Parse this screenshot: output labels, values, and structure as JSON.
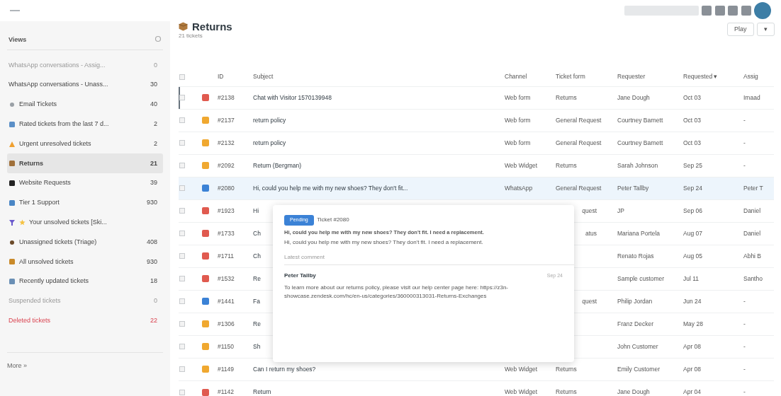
{
  "sidebar": {
    "title": "Views",
    "items": [
      {
        "label": "WhatsApp conversations - Assig...",
        "count": "0",
        "kind": "muted",
        "selected": false
      },
      {
        "label": "WhatsApp conversations - Unass...",
        "count": "30",
        "kind": "plain",
        "selected": false
      },
      {
        "label": "Email Tickets",
        "count": "40",
        "kind": "dot",
        "selected": false,
        "color": "#9aa0a6"
      },
      {
        "label": "Rated tickets from the last 7 d...",
        "count": "2",
        "kind": "folder",
        "selected": false,
        "color": "#5b8fc7"
      },
      {
        "label": "Urgent unresolved tickets",
        "count": "2",
        "kind": "warning",
        "selected": false,
        "color": "#f0a030"
      },
      {
        "label": "Returns",
        "count": "21",
        "kind": "folder",
        "selected": true,
        "color": "#a0703a"
      },
      {
        "label": "Website Requests",
        "count": "39",
        "kind": "folder",
        "selected": false,
        "color": "#222222"
      },
      {
        "label": "Tier 1 Support",
        "count": "930",
        "kind": "folder",
        "selected": false,
        "color": "#4a86c5"
      },
      {
        "label": "Your unsolved tickets [Ski...",
        "kind": "filter",
        "selected": false,
        "color": "#6a5acd"
      },
      {
        "label": "Unassigned tickets (Triage)",
        "count": "408",
        "kind": "dot",
        "selected": false,
        "color": "#6b4a2a"
      },
      {
        "label": "All unsolved tickets",
        "count": "930",
        "kind": "folder",
        "selected": false,
        "color": "#c98a2a"
      },
      {
        "label": "Recently updated tickets",
        "count": "18",
        "kind": "folder",
        "selected": false,
        "color": "#6a8fb5"
      },
      {
        "label": "Suspended tickets",
        "count": "0",
        "kind": "muted",
        "selected": false
      },
      {
        "label": "Deleted tickets",
        "count": "22",
        "kind": "deleted",
        "selected": false
      }
    ],
    "more": "More »"
  },
  "view": {
    "title": "Returns",
    "subtitle": "21 tickets",
    "play": "Play",
    "menu": "▾"
  },
  "table": {
    "select_all": {
      "checked": false
    },
    "columns": [
      "ID",
      "Subject",
      "Channel",
      "Ticket form",
      "Requester",
      "Requested ▾",
      "Assig"
    ],
    "rows": [
      {
        "checked": false,
        "focused": true,
        "hovered": false,
        "color": "#e05a4f",
        "id": "#2138",
        "subject": "Chat with Visitor 1570139948",
        "channel": "Web form",
        "form": "Returns",
        "requester": "Jane Dough",
        "requested": "Oct 03",
        "assignee": "Imaad"
      },
      {
        "checked": false,
        "focused": false,
        "hovered": false,
        "color": "#f0a830",
        "id": "#2137",
        "subject": "return policy",
        "channel": "Web form",
        "form": "General Request",
        "requester": "Courtney Barnett",
        "requested": "Oct 03",
        "assignee": "-"
      },
      {
        "checked": false,
        "focused": false,
        "hovered": false,
        "color": "#f0a830",
        "id": "#2132",
        "subject": "return policy",
        "channel": "Web form",
        "form": "General Request",
        "requester": "Courtney Barnett",
        "requested": "Oct 03",
        "assignee": "-"
      },
      {
        "checked": false,
        "focused": false,
        "hovered": false,
        "color": "#f0a830",
        "id": "#2092",
        "subject": "Return (Bergman)",
        "channel": "Web Widget",
        "form": "Returns",
        "requester": "Sarah Johnson",
        "requested": "Sep 25",
        "assignee": "-"
      },
      {
        "checked": false,
        "focused": false,
        "hovered": true,
        "color": "#3b82d6",
        "id": "#2080",
        "subject": "Hi, could you help me with my new shoes? They don't fit...",
        "channel": "WhatsApp",
        "form": "General Request",
        "requester": "Peter Tallby",
        "requested": "Sep 24",
        "assignee": "Peter T"
      },
      {
        "checked": false,
        "focused": false,
        "hovered": false,
        "color": "#e05a4f",
        "id": "#1923",
        "subject": "Hi",
        "covered": true,
        "form": "quest",
        "requester": "JP",
        "requested": "Sep 06",
        "assignee": "Daniel"
      },
      {
        "checked": false,
        "focused": false,
        "hovered": false,
        "color": "#e05a4f",
        "id": "#1733",
        "subject": "Ch",
        "covered": true,
        "form": "atus",
        "requester": "Mariana Portela",
        "requested": "Aug 07",
        "assignee": "Daniel"
      },
      {
        "checked": false,
        "focused": false,
        "hovered": false,
        "color": "#e05a4f",
        "id": "#1711",
        "subject": "Ch",
        "requester": "Renato Rojas",
        "requested": "Aug 05",
        "assignee": "Abhi B"
      },
      {
        "checked": false,
        "focused": false,
        "hovered": false,
        "color": "#e05a4f",
        "id": "#1532",
        "subject": "Re",
        "requester": "Sample customer",
        "requested": "Jul 11",
        "assignee": "Santho"
      },
      {
        "checked": false,
        "focused": false,
        "hovered": false,
        "color": "#3b82d6",
        "id": "#1441",
        "subject": "Fa",
        "covered": true,
        "form": "quest",
        "requester": "Philip Jordan",
        "requested": "Jun 24",
        "assignee": "-"
      },
      {
        "checked": false,
        "focused": false,
        "hovered": false,
        "color": "#f0a830",
        "id": "#1306",
        "subject": "Re",
        "requester": "Franz Decker",
        "requested": "May 28",
        "assignee": "-"
      },
      {
        "checked": false,
        "focused": false,
        "hovered": false,
        "color": "#f0a830",
        "id": "#1150",
        "subject": "Sh",
        "requester": "John Customer",
        "requested": "Apr 08",
        "assignee": "-"
      },
      {
        "checked": false,
        "focused": false,
        "hovered": false,
        "color": "#f0a830",
        "id": "#1149",
        "subject": "Can I return my shoes?",
        "channel": "Web Widget",
        "form": "Returns",
        "requester": "Emily Customer",
        "requested": "Apr 08",
        "assignee": "-"
      },
      {
        "checked": false,
        "focused": false,
        "hovered": false,
        "color": "#e05a4f",
        "id": "#1142",
        "subject": "Return",
        "channel": "Web Widget",
        "form": "Returns",
        "requester": "Jane Dough",
        "requested": "Apr 04",
        "assignee": "-"
      }
    ]
  },
  "popover": {
    "status": "Pending",
    "ticket": "Ticket #2080",
    "subject": "Hi, could you help me with my new shoes? They don't fit. I need a replacement.",
    "description": "Hi, could you help me with my new shoes? They don't fit. I need a replacement.",
    "section": "Latest comment",
    "author": "Peter Tallby",
    "date": "Sep 24",
    "comment": "To learn more about our returns policy, please visit our help center page here: https://z3n-showcase.zendesk.com/hc/en-us/categories/360000313031-Returns-Exchanges"
  }
}
